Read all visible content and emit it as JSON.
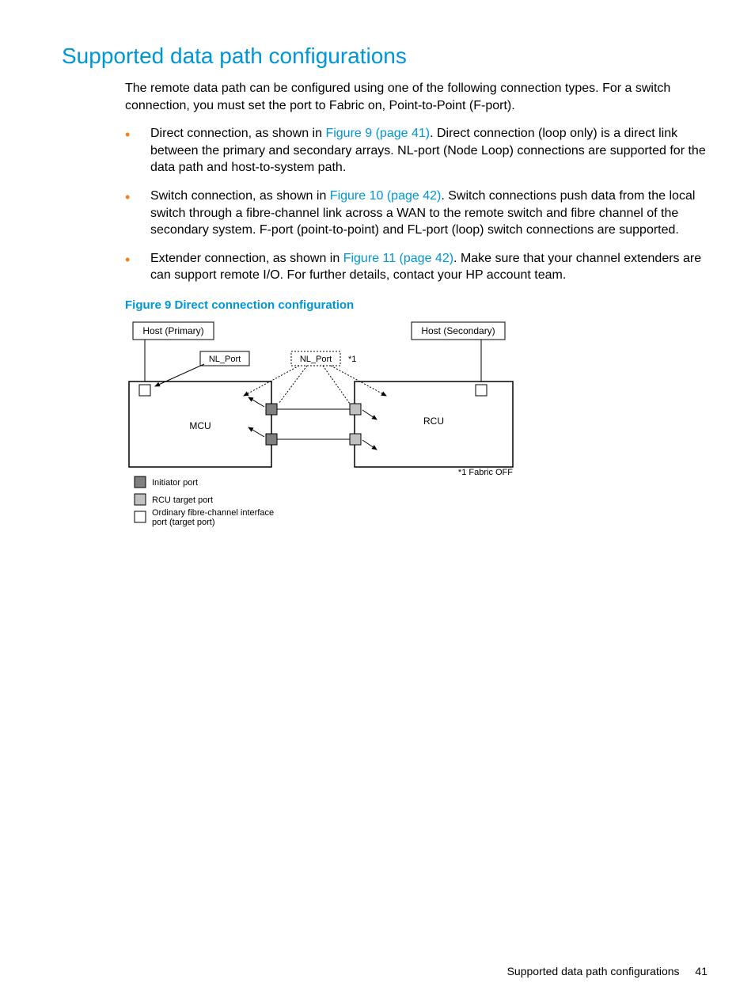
{
  "heading": "Supported data path configurations",
  "intro": "The remote data path can be configured using one of the following connection types. For a switch connection, you must set the port to Fabric on, Point-to-Point (F-port).",
  "bullets": [
    {
      "pre": "Direct connection, as shown in ",
      "link": "Figure 9 (page 41)",
      "post": ". Direct connection (loop only) is a direct link between the primary and secondary arrays. NL-port (Node Loop) connections are supported for the data path and host-to-system path."
    },
    {
      "pre": "Switch connection, as shown in ",
      "link": "Figure 10 (page 42)",
      "post": ". Switch connections push data from the local switch through a fibre-channel link across a WAN to the remote switch and fibre channel of the secondary system. F-port (point-to-point) and FL-port (loop) switch connections are supported."
    },
    {
      "pre": "Extender connection, as shown in ",
      "link": "Figure 11 (page 42)",
      "post": ". Make sure that your channel extenders are can support remote I/O. For further details, contact your HP account team."
    }
  ],
  "figure_caption": "Figure 9 Direct connection configuration",
  "diagram": {
    "host_primary": "Host (Primary)",
    "host_secondary": "Host (Secondary)",
    "nl_port": "NL_Port",
    "nl_port_center": "NL_Port",
    "star1": "*1",
    "mcu": "MCU",
    "rcu": "RCU",
    "fabric_off": "*1 Fabric OFF",
    "legend_initiator": "Initiator port",
    "legend_rcu_target": "RCU target port",
    "legend_ordinary": "Ordinary fibre-channel interface port (target port)"
  },
  "footer_text": "Supported data path configurations",
  "page_number": "41"
}
